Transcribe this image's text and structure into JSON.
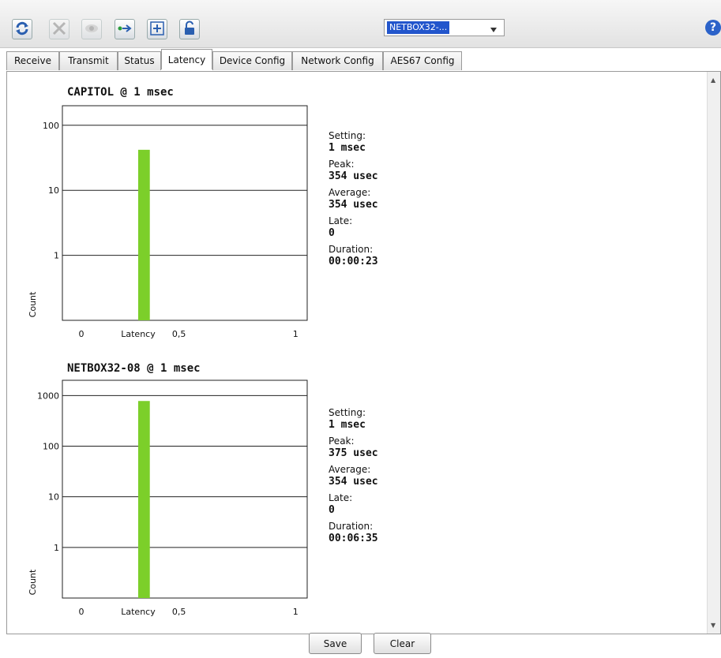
{
  "toolbar": {
    "buttons": [
      {
        "icon": "refresh-icon",
        "enabled": true
      },
      {
        "icon": "tools-icon",
        "enabled": false
      },
      {
        "icon": "eye-icon",
        "enabled": false
      },
      {
        "icon": "network-icon",
        "enabled": true
      },
      {
        "icon": "plus-box-icon",
        "enabled": true
      },
      {
        "icon": "unlock-icon",
        "enabled": true
      }
    ],
    "device_select": {
      "value": "NETBOX32-..."
    },
    "help_label": "?"
  },
  "tabs": [
    {
      "label": "Receive"
    },
    {
      "label": "Transmit"
    },
    {
      "label": "Status"
    },
    {
      "label": "Latency",
      "active": true
    },
    {
      "label": "Device Config"
    },
    {
      "label": "Network Config"
    },
    {
      "label": "AES67 Config"
    }
  ],
  "charts": [
    {
      "title": "CAPITOL @ 1 msec",
      "stats": {
        "setting_label": "Setting:",
        "setting": "1 msec",
        "peak_label": "Peak:",
        "peak": "354 usec",
        "average_label": "Average:",
        "average": "354 usec",
        "late_label": "Late:",
        "late": "0",
        "duration_label": "Duration:",
        "duration": "00:00:23"
      }
    },
    {
      "title": "NETBOX32-08 @ 1 msec",
      "stats": {
        "setting_label": "Setting:",
        "setting": "1 msec",
        "peak_label": "Peak:",
        "peak": "375 usec",
        "average_label": "Average:",
        "average": "354 usec",
        "late_label": "Late:",
        "late": "0",
        "duration_label": "Duration:",
        "duration": "00:06:35"
      }
    }
  ],
  "chart_data": [
    {
      "type": "bar",
      "title": "CAPITOL @ 1 msec",
      "xlabel": "Latency",
      "ylabel": "Count",
      "yscale": "log",
      "ylim": [
        0.1,
        200
      ],
      "xlim": [
        0,
        1.05
      ],
      "xticks": [
        "0",
        "0,5",
        "1"
      ],
      "yticks": [
        "1",
        "10",
        "100"
      ],
      "bars": [
        {
          "x": 0.35,
          "width": 0.05,
          "value": 42
        }
      ],
      "color": "#7ccf2a",
      "grid": "horizontal"
    },
    {
      "type": "bar",
      "title": "NETBOX32-08 @ 1 msec",
      "xlabel": "Latency",
      "ylabel": "Count",
      "yscale": "log",
      "ylim": [
        0.1,
        2000
      ],
      "xlim": [
        0,
        1.05
      ],
      "xticks": [
        "0",
        "0,5",
        "1"
      ],
      "yticks": [
        "1",
        "10",
        "100",
        "1000"
      ],
      "bars": [
        {
          "x": 0.35,
          "width": 0.05,
          "value": 780
        }
      ],
      "color": "#7ccf2a",
      "grid": "horizontal"
    }
  ],
  "footer": {
    "save_label": "Save",
    "clear_label": "Clear"
  }
}
